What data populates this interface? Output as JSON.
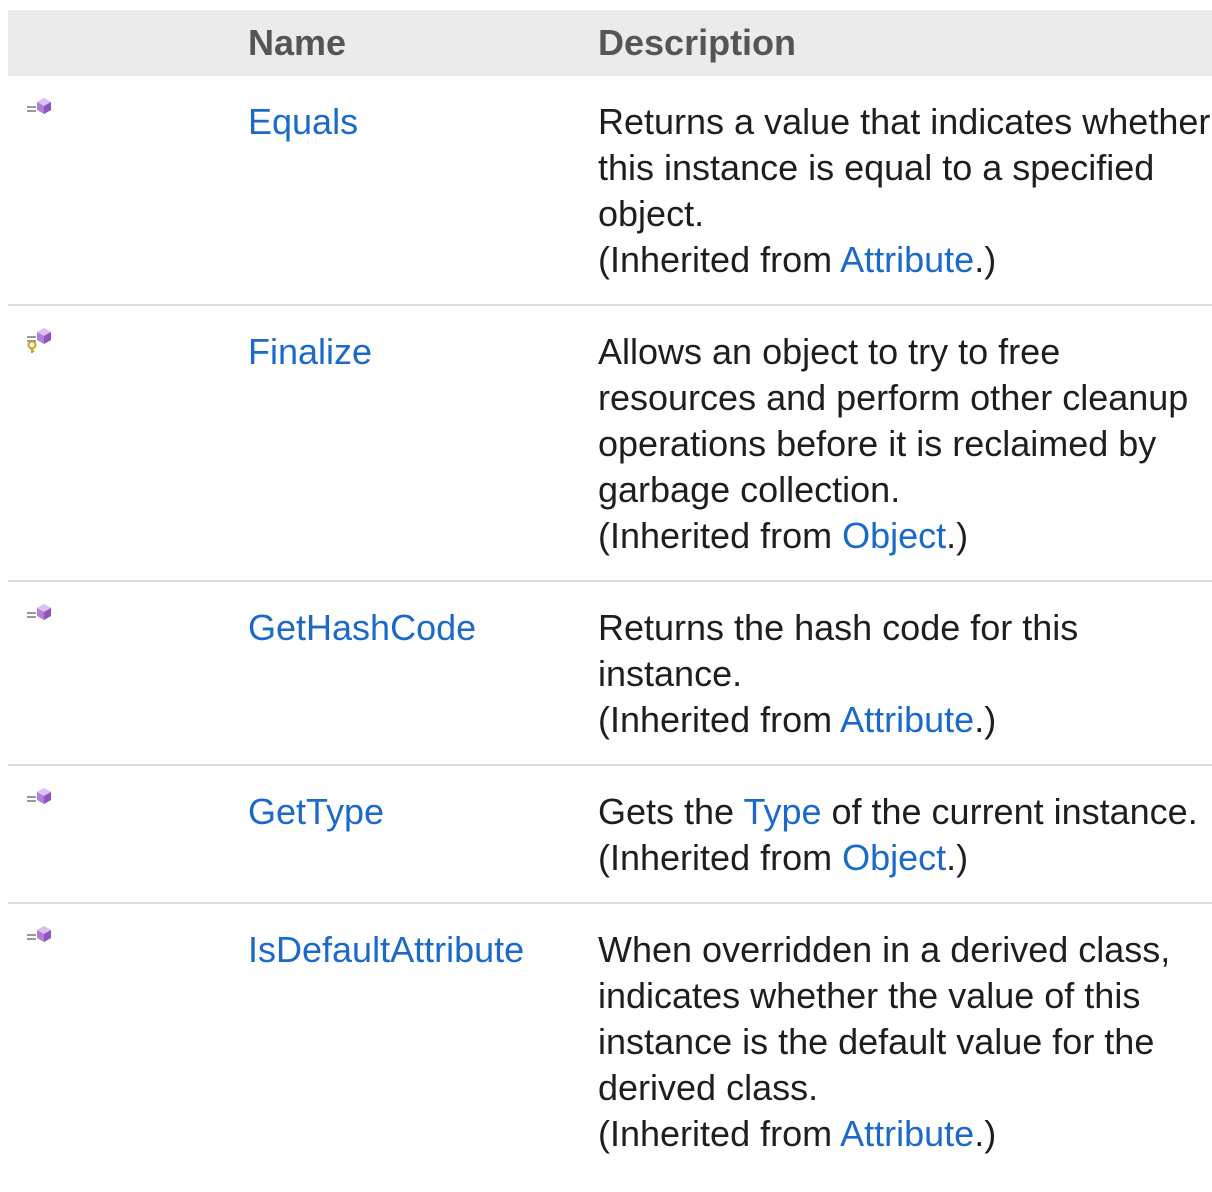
{
  "table": {
    "headers": {
      "icon": "",
      "name": "Name",
      "description": "Description"
    },
    "rows": [
      {
        "icon": "public-method-icon",
        "name": "Equals",
        "description": "Returns a value that indicates whether this instance is equal to a specified object.",
        "inherited_prefix": "(Inherited from ",
        "inherited_link": "Attribute",
        "inherited_suffix": ".)"
      },
      {
        "icon": "protected-method-icon",
        "name": "Finalize",
        "description": "Allows an object to try to free resources and perform other cleanup operations before it is reclaimed by garbage collection.",
        "inherited_prefix": "(Inherited from ",
        "inherited_link": "Object",
        "inherited_suffix": ".)"
      },
      {
        "icon": "public-method-icon",
        "name": "GetHashCode",
        "description": "Returns the hash code for this instance.",
        "inherited_prefix": "(Inherited from ",
        "inherited_link": "Attribute",
        "inherited_suffix": ".)"
      },
      {
        "icon": "public-method-icon",
        "name": "GetType",
        "description_before": "Gets the ",
        "description_link": "Type",
        "description_after": " of the current instance.",
        "inherited_prefix": "(Inherited from ",
        "inherited_link": "Object",
        "inherited_suffix": ".)"
      },
      {
        "icon": "public-method-icon",
        "name": "IsDefaultAttribute",
        "description": "When overridden in a derived class, indicates whether the value of this instance is the default value for the derived class.",
        "inherited_prefix": "(Inherited from ",
        "inherited_link": "Attribute",
        "inherited_suffix": ".)"
      }
    ]
  },
  "colors": {
    "link": "#1b6ac9",
    "header_bg": "#ebebeb",
    "header_text": "#555555",
    "method_icon": "#b27fd6"
  }
}
